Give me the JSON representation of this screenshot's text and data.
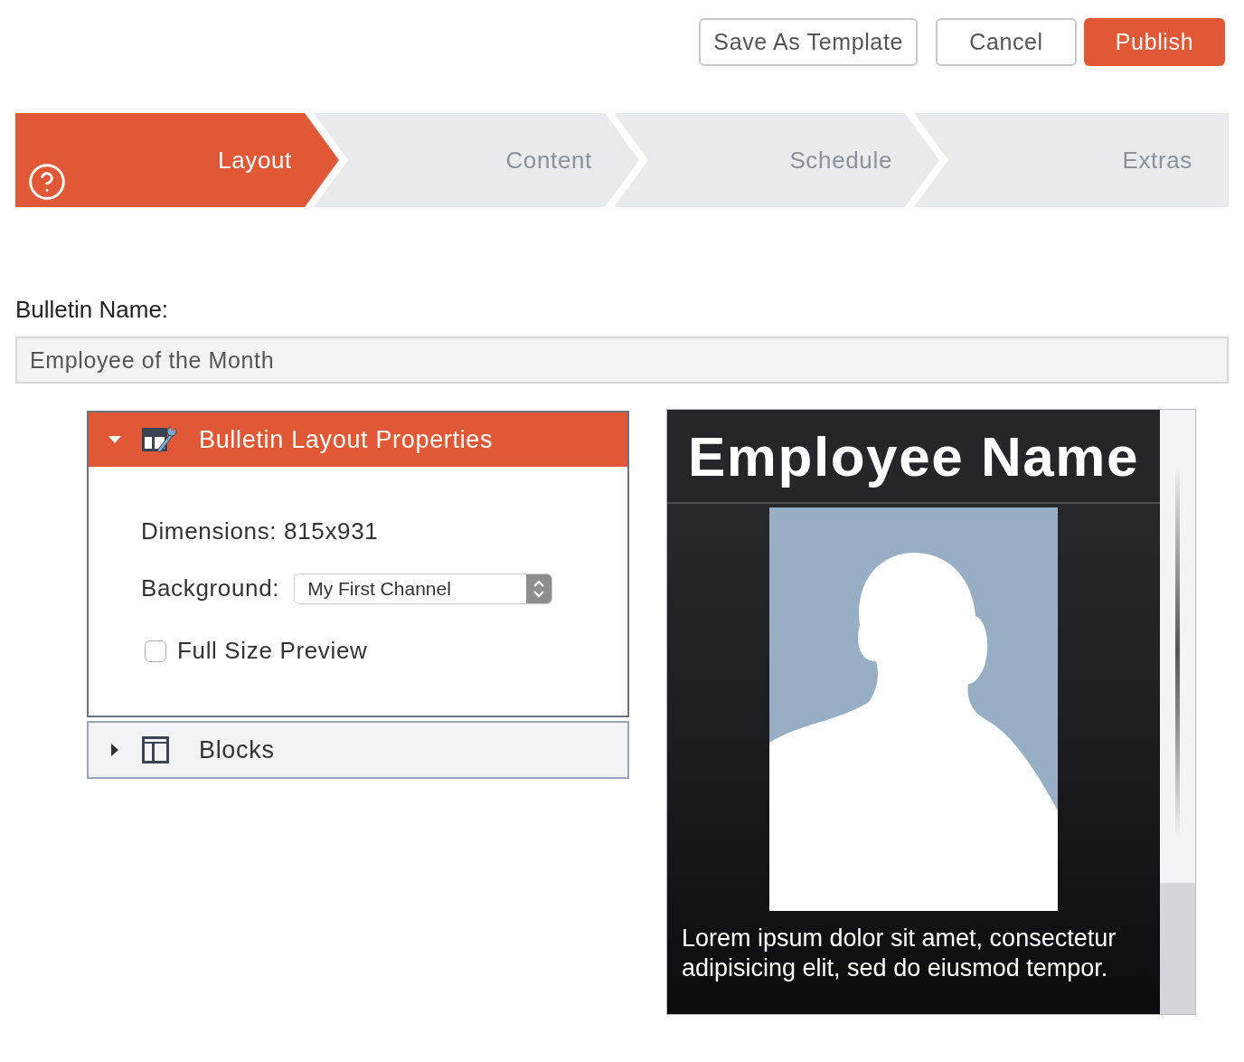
{
  "header_buttons": [
    {
      "label": "Save As Template",
      "kind": "outline"
    },
    {
      "label": "Cancel",
      "kind": "outline"
    },
    {
      "label": "Publish",
      "kind": "primary"
    }
  ],
  "steps": [
    {
      "label": "Layout",
      "selected": true
    },
    {
      "label": "Content",
      "selected": false
    },
    {
      "label": "Schedule",
      "selected": false
    },
    {
      "label": "Extras",
      "selected": false
    }
  ],
  "bulletin_name": {
    "label": "Bulletin Name:",
    "value": "Employee of the Month"
  },
  "panels": [
    {
      "title": "Bulletin Layout Properties",
      "expanded": true,
      "kind": "properties"
    },
    {
      "title": "Blocks",
      "expanded": false,
      "kind": "blocks"
    }
  ],
  "properties": {
    "dimensions": "Dimensions: 815x931",
    "background_label": "Background:",
    "background": "My First Channel",
    "full_size_preview": {
      "label": "Full Size Preview",
      "checked": false
    }
  },
  "preview": {
    "title": "Employee Name",
    "caption": "Lorem ipsum dolor sit amet, consectetur adipisicing elit, sed do eiusmod tempor."
  }
}
